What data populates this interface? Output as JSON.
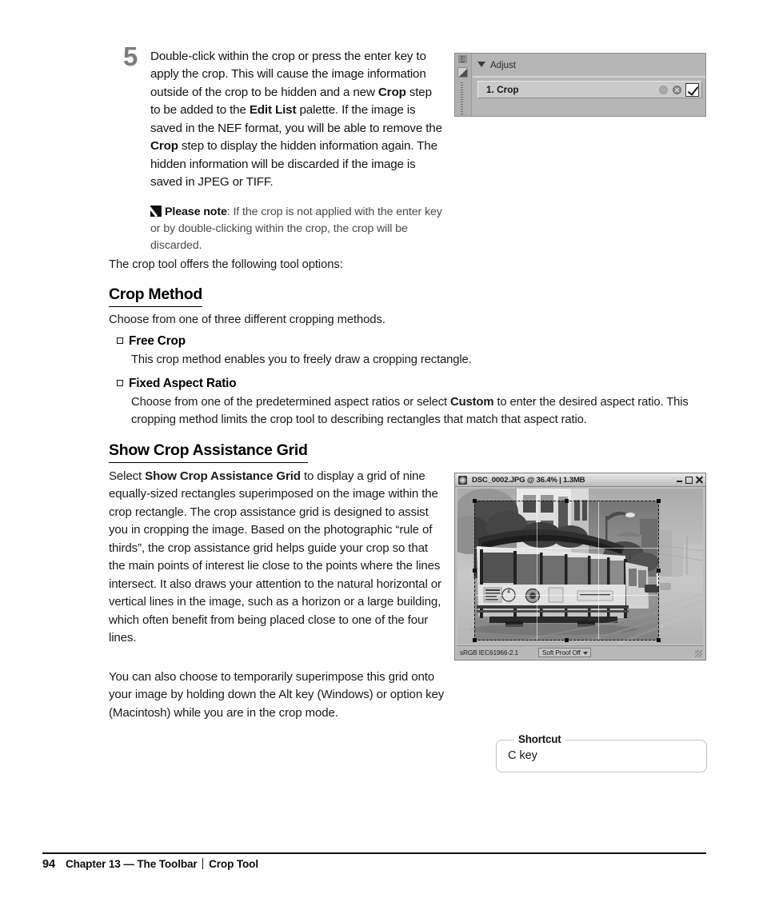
{
  "step": {
    "number": "5",
    "text_parts": [
      {
        "t": "Double-click within the crop or press the enter key to apply the crop. This will cause the image information outside of the crop to be hidden and a new ",
        "b": false
      },
      {
        "t": "Crop",
        "b": true
      },
      {
        "t": " step to be added to the ",
        "b": false
      },
      {
        "t": "Edit List",
        "b": true
      },
      {
        "t": " palette. If the image is saved in the NEF format, you will be able to remove the ",
        "b": false
      },
      {
        "t": "Crop",
        "b": true
      },
      {
        "t": " step to display the hidden information again. The hidden information will be discarded if the image is saved in JPEG or TIFF.",
        "b": false
      }
    ]
  },
  "note": {
    "icon": "pencil-icon",
    "label": "Please note",
    "text": ": If the crop is not applied with the enter key or by double-clicking within the crop, the crop will be discarded."
  },
  "intro_line": "The crop tool offers the following tool options:",
  "crop_method": {
    "heading": "Crop Method",
    "intro": "Choose from one of three different cropping methods.",
    "options": [
      {
        "title": "Free Crop",
        "desc_parts": [
          {
            "t": "This crop method enables you to freely draw a cropping rectangle.",
            "b": false
          }
        ]
      },
      {
        "title": "Fixed Aspect Ratio",
        "desc_parts": [
          {
            "t": "Choose from one of the predetermined aspect ratios or select ",
            "b": false
          },
          {
            "t": "Custom",
            "b": true
          },
          {
            "t": " to enter the desired aspect ratio. This cropping method limits the crop tool to describing rectangles that match that aspect ratio.",
            "b": false
          }
        ]
      }
    ]
  },
  "crop_grid": {
    "heading": "Show Crop Assistance Grid",
    "para1_parts": [
      {
        "t": "Select ",
        "b": false
      },
      {
        "t": "Show Crop Assistance Grid",
        "b": true
      },
      {
        "t": " to display a grid of nine equally-sized rectangles superimposed on the image within the crop rectangle. The crop assistance grid is designed to assist you in cropping the image. Based on the photographic “rule of thirds”, the crop assistance grid helps guide your crop so that the main points of interest lie close to the points where the lines intersect. It also draws your attention to the natural horizontal or vertical lines in the image, such as a horizon or a large building, which often benefit from being placed close to one of the four lines.",
        "b": false
      }
    ],
    "para2": "You can also choose to temporarily superimpose this grid onto your image by holding down the Alt key (Windows) or option key (Macintosh) while you are in the crop mode."
  },
  "adjust_palette": {
    "header_label": "Adjust",
    "disclosure_icon": "triangle-down-icon",
    "step_row": {
      "label": "1. Crop",
      "icons": [
        "circle-icon",
        "close-circle-icon",
        "checkbox-checked-icon"
      ],
      "checked": true
    },
    "rail_icons": [
      "layers-icon",
      "gradient-swatch-icon",
      "dotted-grip-icon"
    ]
  },
  "image_window": {
    "title": "DSC_0002.JPG @ 36.4% | 1.3MB",
    "app_icon": "nikon-capture-icon",
    "window_buttons": [
      "minimize-icon",
      "maximize-icon",
      "close-icon"
    ],
    "photo_description": "Grayscale photograph of a San Francisco cable car on a city street",
    "crop_overlay": {
      "grid": "rule-of-thirds",
      "handles": 8
    },
    "status": {
      "color_profile": "sRGB IEC61966-2.1",
      "soft_proof": "Soft Proof Off",
      "soft_proof_caret": "caret-down-icon",
      "resize_grip": "resize-grip-icon"
    }
  },
  "shortcut": {
    "legend": "Shortcut",
    "value": "C key"
  },
  "footer": {
    "page_number": "94",
    "chapter": "Chapter 13 — The Toolbar",
    "section": "Crop Tool"
  },
  "colors": {
    "page_bg": "#ffffff",
    "text": "#1a1a1a",
    "step_number": "#7d7d7d",
    "palette_bg": "#b6b6b6",
    "window_chrome": "#bfbfbf",
    "shortcut_border": "#c3c3c3"
  }
}
